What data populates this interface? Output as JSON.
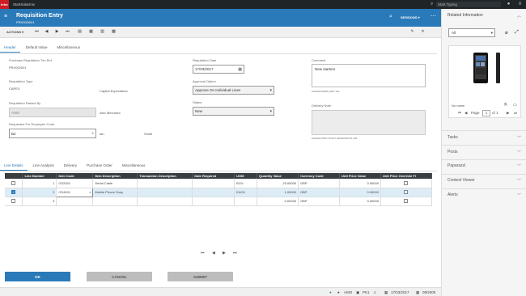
{
  "topbar": {
    "brand": "infor",
    "app_name": "StartSolarmix",
    "search_placeholder": "Start Typing"
  },
  "header": {
    "title": "Requisition Entry",
    "subtitle": "PRX00200/1",
    "sessions_label": "SESSIONS ▾"
  },
  "toolbar": {
    "actions_label": "ACTIONS ▾"
  },
  "tabs": [
    "Header",
    "Default Value",
    "Miscellaneous"
  ],
  "form": {
    "purchase_req_label": "Purchase Requisition Txn Ref",
    "purchase_req_value": "PRX002001",
    "req_type_label": "Requisition Type",
    "req_type_value": "CAPEX",
    "req_type_desc": "Capital Expenditure",
    "raised_by_label": "Requisition Raised By",
    "raised_by_value": "AMO",
    "raised_by_name": "Alex Merchant",
    "requested_for_label": "Requested For Employee Code",
    "requested_for_value": "B2",
    "requested_for_first": "Ian",
    "requested_for_last": "Smith",
    "req_date_label": "Requisition Date",
    "req_date_value": "17/03/2017",
    "approval_label": "Approval Option",
    "approval_value": "Approve On Individual Lines",
    "status_label": "Status",
    "status_value": "New",
    "comment_label": "Comment",
    "comment_value": "New starters",
    "comment_chars": "CHARACTERS LEFT 241",
    "delivery_label": "Delivery Note",
    "delivery_chars": "CHARACTER COUNT MAXIMUM OF 255"
  },
  "line_tabs": [
    "Line Details",
    "Line Analysis",
    "Delivery",
    "Purchase Order",
    "Miscellaneous"
  ],
  "table": {
    "columns": [
      "Line Number",
      "Item Code",
      "Item Description",
      "Transaction Description",
      "Date Required",
      "UOM",
      "Quantity Value",
      "Currency Code",
      "Unit Price Value",
      "Unit Price Override Fl"
    ],
    "rows": [
      {
        "line": "1",
        "item": "GS2001",
        "desc": "Serial Cable",
        "txn": "",
        "date": "",
        "uom": "BOX",
        "qty": "25.00000",
        "cur": "GBP",
        "price": "0.00000",
        "checked": false
      },
      {
        "line": "2",
        "item": "GS4001",
        "desc": "Mobile Phone Sony",
        "txn": "",
        "date": "",
        "uom": "EACH",
        "qty": "1.00000",
        "cur": "GBP",
        "price": "0.00000",
        "checked": true
      },
      {
        "line": "3",
        "item": "",
        "desc": "",
        "txn": "",
        "date": "",
        "uom": "",
        "qty": "0.00000",
        "cur": "GBP",
        "price": "0.00000",
        "checked": false
      }
    ]
  },
  "buttons": {
    "ok": "OK",
    "cancel": "CANCEL",
    "submit": "SUBMIT"
  },
  "statusbar": {
    "user": "AMO",
    "company": "PK1",
    "date": "17/03/2017",
    "period": "09/2005"
  },
  "right_panel": {
    "title": "Related Information",
    "filter_value": "All",
    "image_caption": "No name",
    "page_label": "Page",
    "page_value": "1",
    "page_of": "of 1",
    "sections": [
      "Tasks",
      "Posts",
      "Paparazzi",
      "Context Viewer",
      "Alerts"
    ]
  },
  "colors": {
    "accent": "#2a7ab9",
    "topbar": "#1f2427",
    "brand": "#d01b24"
  }
}
